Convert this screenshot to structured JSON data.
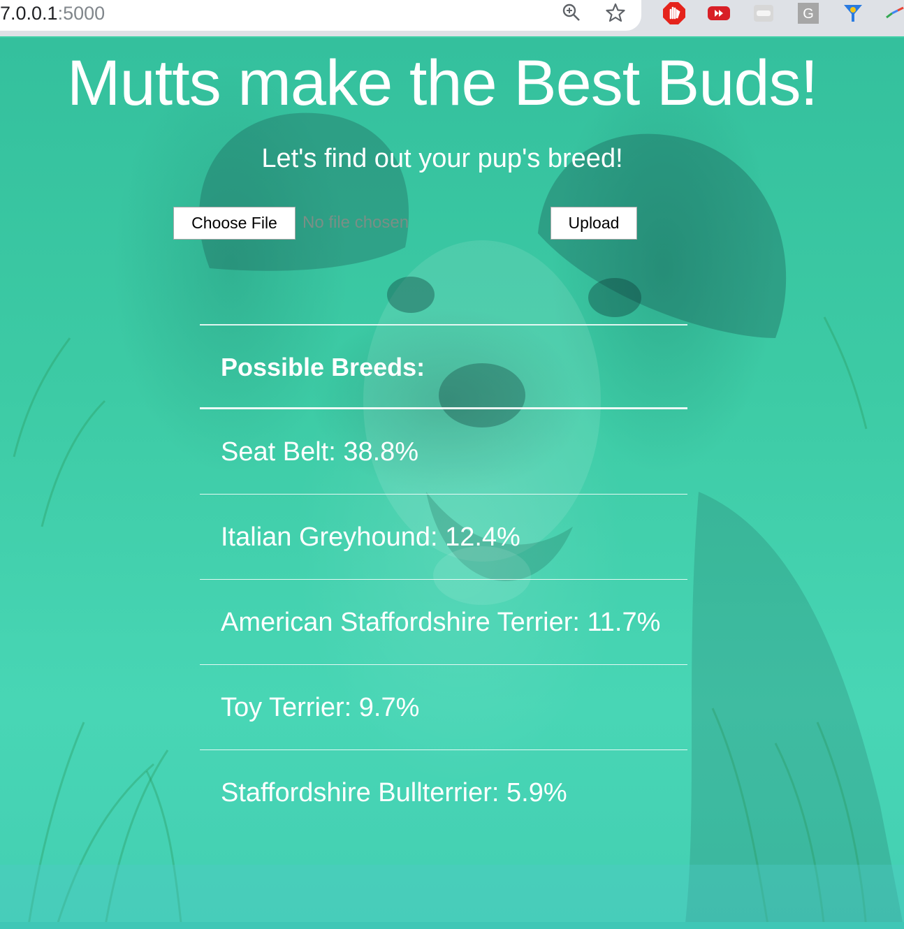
{
  "browser": {
    "url_host": "7.0.0.1",
    "url_port": ":5000",
    "icons": [
      "zoom-icon",
      "star-icon"
    ],
    "extensions": [
      "adblock-icon",
      "youtube-icon",
      "extension-box-icon",
      "grammarly-icon",
      "funnel-icon",
      "slash-icon"
    ]
  },
  "page": {
    "title": "Mutts make the Best Buds!",
    "subtitle": "Let's find out your pup's breed!",
    "file_button_label": "Choose File",
    "file_status": "No file chosen",
    "upload_button_label": "Upload",
    "results_header": "Possible Breeds:",
    "breeds": [
      "Seat Belt: 38.8%",
      "Italian Greyhound: 12.4%",
      "American Staffordshire Terrier: 11.7%",
      "Toy Terrier: 9.7%",
      "Staffordshire Bullterrier: 5.9%"
    ]
  },
  "colors": {
    "teal_background": "#3fcfa6",
    "text": "#ffffff"
  }
}
